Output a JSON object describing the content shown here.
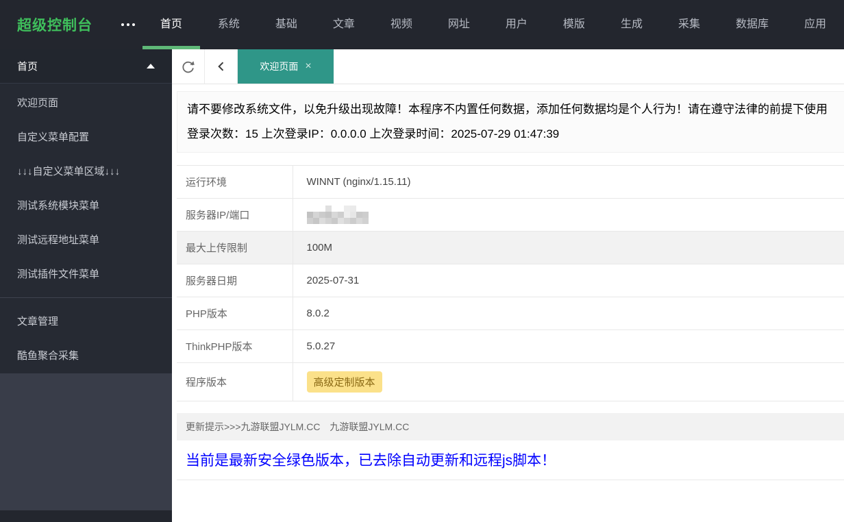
{
  "header": {
    "logo": "超级控制台",
    "more_icon": "ellipsis-dots",
    "nav": [
      {
        "label": "首页",
        "active": true
      },
      {
        "label": "系统",
        "active": false
      },
      {
        "label": "基础",
        "active": false
      },
      {
        "label": "文章",
        "active": false
      },
      {
        "label": "视频",
        "active": false
      },
      {
        "label": "网址",
        "active": false
      },
      {
        "label": "用户",
        "active": false
      },
      {
        "label": "模版",
        "active": false
      },
      {
        "label": "生成",
        "active": false
      },
      {
        "label": "采集",
        "active": false
      },
      {
        "label": "数据库",
        "active": false
      },
      {
        "label": "应用",
        "active": false
      }
    ]
  },
  "sidebar": {
    "groups": [
      {
        "header": {
          "label": "首页",
          "expanded": true
        },
        "items": [
          "欢迎页面",
          "自定义菜单配置",
          "↓↓↓自定义菜单区域↓↓↓",
          "测试系统模块菜单",
          "测试远程地址菜单",
          "测试插件文件菜单"
        ]
      },
      {
        "header": null,
        "items": [
          "文章管理",
          "酷鱼聚合采集"
        ]
      }
    ]
  },
  "tabbar": {
    "refresh_icon": "refresh",
    "back_icon": "chevron-left",
    "active_tab": {
      "label": "欢迎页面",
      "close_glyph": "×"
    }
  },
  "notice": {
    "line1": "请不要修改系统文件，以免升级出现故障！本程序不内置任何数据，添加任何数据均是个人行为！请在遵守法律的前提下使用",
    "line2": "登录次数：15 上次登录IP：0.0.0.0 上次登录时间：2025-07-29 01:47:39"
  },
  "info_table": {
    "rows": [
      {
        "label": "运行环境",
        "value": "WINNT (nginx/1.15.11)"
      },
      {
        "label": "服务器IP/端口",
        "value": "",
        "redacted": true
      },
      {
        "label": "最大上传限制",
        "value": "100M",
        "highlight_row": true
      },
      {
        "label": "服务器日期",
        "value": "2025-07-31"
      },
      {
        "label": "PHP版本",
        "value": "8.0.2"
      },
      {
        "label": "ThinkPHP版本",
        "value": "5.0.27"
      },
      {
        "label": "程序版本",
        "value": "高级定制版本",
        "badge": true,
        "tall": true
      }
    ]
  },
  "footer": {
    "update_bar": "更新提示>>>九游联盟JYLM.CC　九游联盟JYLM.CC",
    "blue_notice": "当前是最新安全绿色版本，已去除自动更新和远程js脚本！"
  },
  "colors": {
    "header_bg": "#23262E",
    "sidebar_bg": "#393D49",
    "menu_bg": "#262A33",
    "logo_green": "#3FBF5C",
    "nav_underline_green": "#5FB878",
    "tab_teal": "#2F9688",
    "badge_yellow": "#FBE18A",
    "row_highlight": "#F2F2F2",
    "blue_text": "#0000FF"
  }
}
